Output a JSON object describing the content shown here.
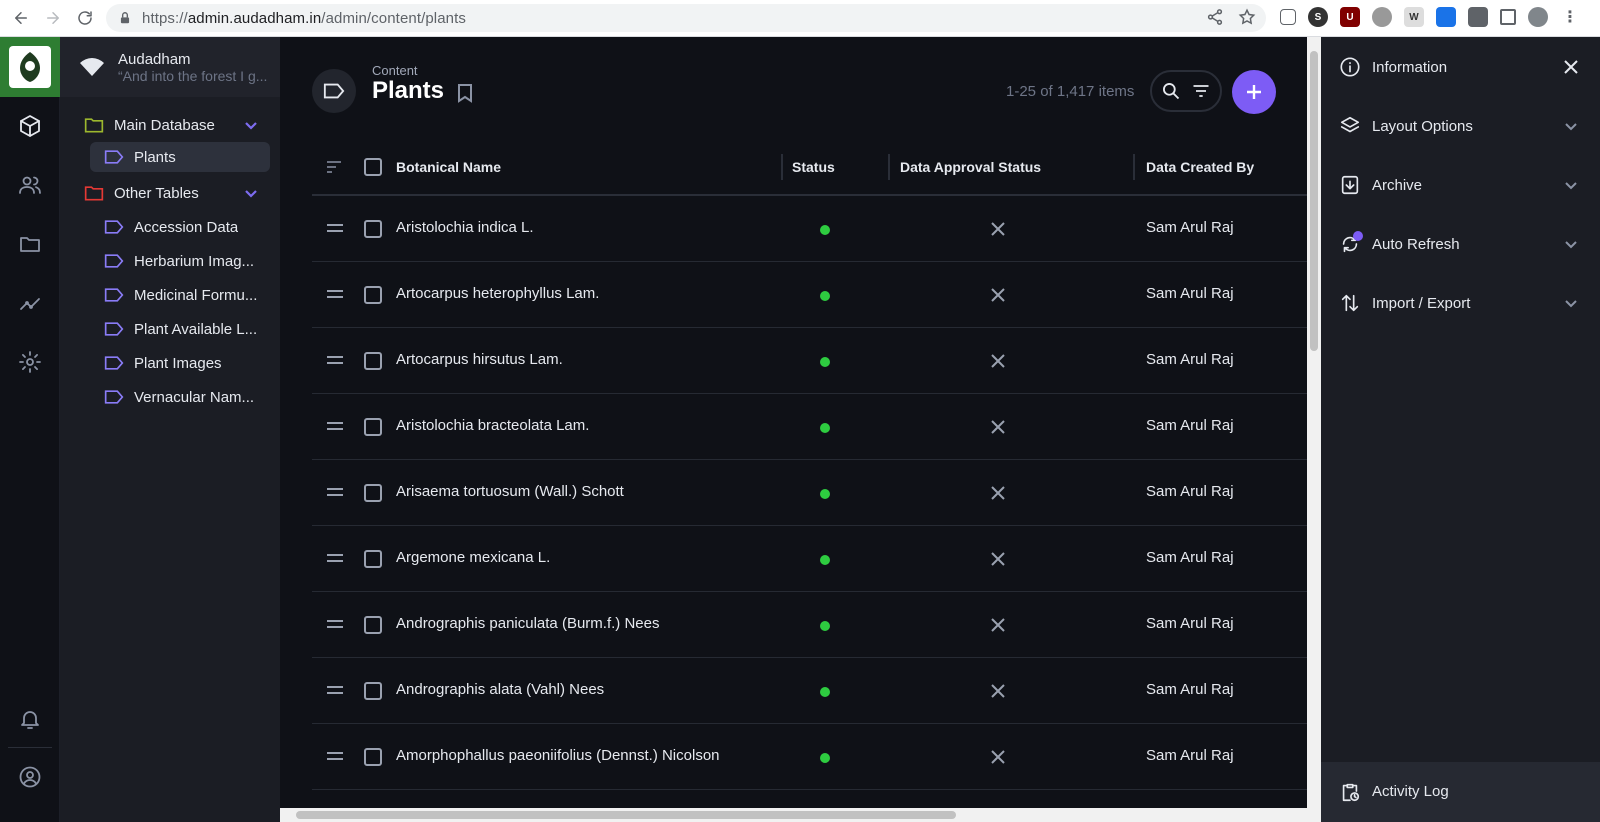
{
  "browser": {
    "url_prefix": "https://",
    "url_host": "admin.audadham.in",
    "url_path": "/admin/content/plants"
  },
  "project": {
    "name": "Audadham",
    "description": "“And into the forest I g..."
  },
  "nav": {
    "main_db": "Main Database",
    "plants": "Plants",
    "other_tables": "Other Tables",
    "items": [
      "Accession Data",
      "Herbarium Imag...",
      "Medicinal Formu...",
      "Plant Available L...",
      "Plant Images",
      "Vernacular Nam..."
    ]
  },
  "header": {
    "breadcrumb": "Content",
    "title": "Plants",
    "count": "1-25 of 1,417 items"
  },
  "table": {
    "columns": [
      "Botanical Name",
      "Status",
      "Data Approval Status",
      "Data Created By"
    ],
    "rows": [
      {
        "name": "Aristolochia indica L.",
        "created_by": "Sam Arul Raj"
      },
      {
        "name": "Artocarpus heterophyllus Lam.",
        "created_by": "Sam Arul Raj"
      },
      {
        "name": "Artocarpus hirsutus Lam.",
        "created_by": "Sam Arul Raj"
      },
      {
        "name": "Aristolochia bracteolata Lam.",
        "created_by": "Sam Arul Raj"
      },
      {
        "name": "Arisaema tortuosum (Wall.) Schott",
        "created_by": "Sam Arul Raj"
      },
      {
        "name": "Argemone mexicana L.",
        "created_by": "Sam Arul Raj"
      },
      {
        "name": "Andrographis paniculata (Burm.f.) Nees",
        "created_by": "Sam Arul Raj"
      },
      {
        "name": "Andrographis alata (Vahl) Nees",
        "created_by": "Sam Arul Raj"
      },
      {
        "name": "Amorphophallus paeoniifolius (Dennst.) Nicolson",
        "created_by": "Sam Arul Raj"
      }
    ]
  },
  "sidebar": {
    "information": "Information",
    "layout_options": "Layout Options",
    "archive": "Archive",
    "auto_refresh": "Auto Refresh",
    "import_export": "Import / Export",
    "activity_log": "Activity Log"
  },
  "colors": {
    "accent": "#7d5cf5",
    "status_green": "#2ecc40",
    "logo_green": "#2e7d32"
  }
}
